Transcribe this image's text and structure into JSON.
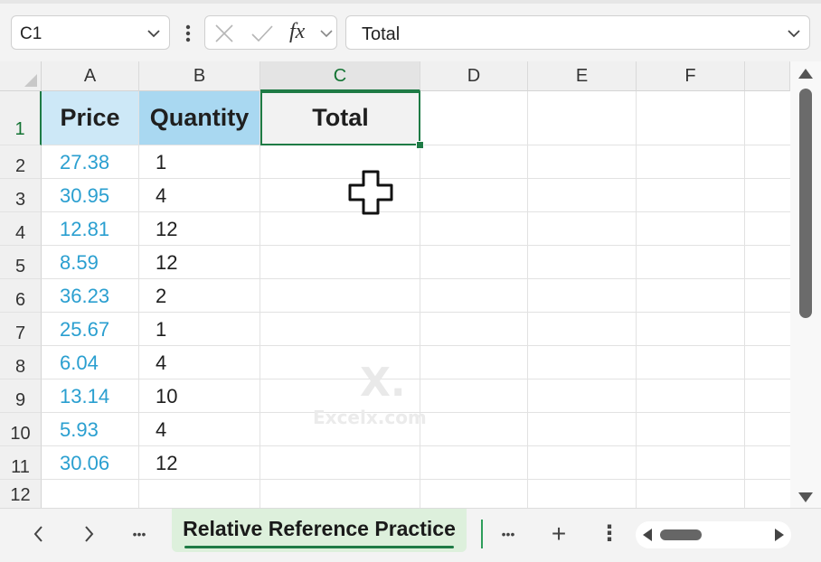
{
  "formula_bar": {
    "name_box": "C1",
    "formula": "Total",
    "fx_label": "fx",
    "icons": [
      "chevron-down-icon",
      "kebab-icon",
      "cancel-x-icon",
      "confirm-check-icon",
      "fx-icon"
    ]
  },
  "columns": [
    "A",
    "B",
    "C",
    "D",
    "E",
    "F"
  ],
  "selected_column": "C",
  "rows": [
    "1",
    "2",
    "3",
    "4",
    "5",
    "6",
    "7",
    "8",
    "9",
    "10",
    "11",
    "12"
  ],
  "selected_row": "1",
  "headers": {
    "a": "Price",
    "b": "Quantity",
    "c": "Total"
  },
  "data": [
    {
      "price": "27.38",
      "qty": "1"
    },
    {
      "price": "30.95",
      "qty": "4"
    },
    {
      "price": "12.81",
      "qty": "12"
    },
    {
      "price": "8.59",
      "qty": "12"
    },
    {
      "price": "36.23",
      "qty": "2"
    },
    {
      "price": "25.67",
      "qty": "1"
    },
    {
      "price": "6.04",
      "qty": "4"
    },
    {
      "price": "13.14",
      "qty": "10"
    },
    {
      "price": "5.93",
      "qty": "4"
    },
    {
      "price": "30.06",
      "qty": "12"
    }
  ],
  "watermark": {
    "logo": "X.",
    "text": "Excelx.com"
  },
  "tabs": {
    "prev": "‹",
    "next": "›",
    "more": "•••",
    "active_sheet": "Relative Reference Practice",
    "more2": "•••",
    "add": "+",
    "menu": "⋮"
  },
  "colors": {
    "accent": "#1e7b45",
    "price_text": "#2a9fd0",
    "header_fill": "#cde8f7",
    "header_fill_b": "#a9d8f1"
  }
}
